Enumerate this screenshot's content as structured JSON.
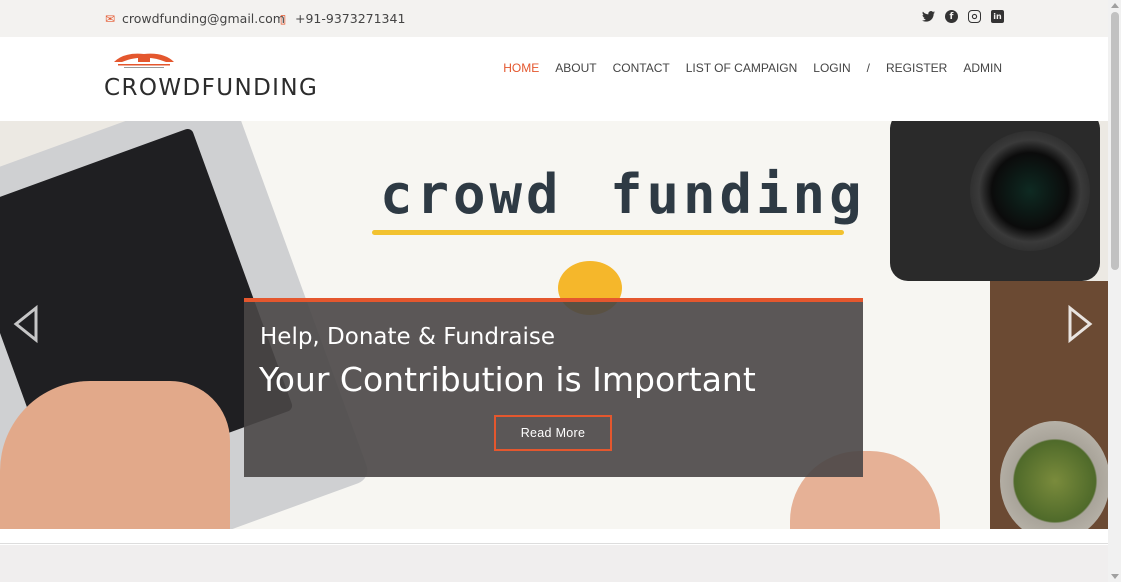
{
  "topbar": {
    "email": "crowdfunding@gmail.com",
    "phone": "+91-9373271341",
    "email_icon": "envelope-icon",
    "phone_icon": "mobile-phone-icon",
    "social": [
      "twitter-icon",
      "facebook-icon",
      "instagram-icon",
      "linkedin-icon"
    ]
  },
  "header": {
    "logo_text": "CROWDFUNDING",
    "nav": {
      "home": "HOME",
      "about": "ABOUT",
      "contact": "CONTACT",
      "campaigns": "LIST OF CAMPAIGN",
      "login": "LOGIN",
      "separator": "/",
      "register": "REGISTER",
      "admin": "ADMIN"
    }
  },
  "hero": {
    "image_text_1": "crowd",
    "image_text_2": "funding",
    "subtitle": "Help, Donate & Fundraise",
    "title": "Your Contribution is Important",
    "button": "Read More"
  },
  "colors": {
    "accent": "#e4572e",
    "topbar_bg": "#f3f2f0",
    "caption_bg": "#494646"
  }
}
